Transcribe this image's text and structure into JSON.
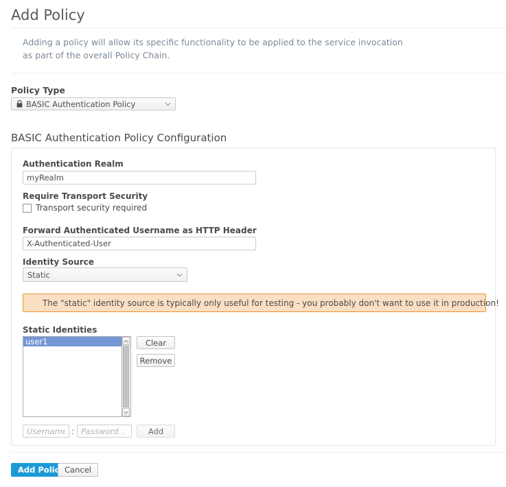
{
  "header": {
    "title": "Add Policy",
    "intro_line1": "Adding a policy will allow its specific functionality to be applied to the service invocation",
    "intro_line2": "as part of the overall Policy Chain."
  },
  "policy_type": {
    "label": "Policy Type",
    "selected": "BASIC Authentication Policy",
    "icon": "lock-icon",
    "chevron": "chevron-down-icon"
  },
  "config": {
    "title": "BASIC Authentication Policy Configuration",
    "realm": {
      "label": "Authentication Realm",
      "value": "myRealm"
    },
    "transport": {
      "label": "Require Transport Security",
      "checkbox_label": "Transport security required",
      "checked": false
    },
    "forward_header": {
      "label": "Forward Authenticated Username as HTTP Header",
      "value": "X-Authenticated-User"
    },
    "identity_source": {
      "label": "Identity Source",
      "selected": "Static",
      "chevron": "chevron-down-icon"
    },
    "warning": {
      "text": "The \"static\" identity source is typically only useful for testing - you probably don't want to use it in production!",
      "background": "#fadfc3",
      "border": "#e89331"
    },
    "static_identities": {
      "label": "Static Identities",
      "items": [
        {
          "name": "user1",
          "selected": true
        }
      ],
      "selected_color": "#7396d4",
      "clear_label": "Clear",
      "remove_label": "Remove",
      "username_placeholder": "Username...",
      "password_placeholder": "Password...",
      "separator": ":",
      "add_label": "Add",
      "scroll_up_icon": "chevron-up-icon",
      "scroll_down_icon": "chevron-down-icon"
    }
  },
  "footer": {
    "submit_label": "Add Policy",
    "submit_color": "#1b9ad6",
    "cancel_label": "Cancel"
  }
}
